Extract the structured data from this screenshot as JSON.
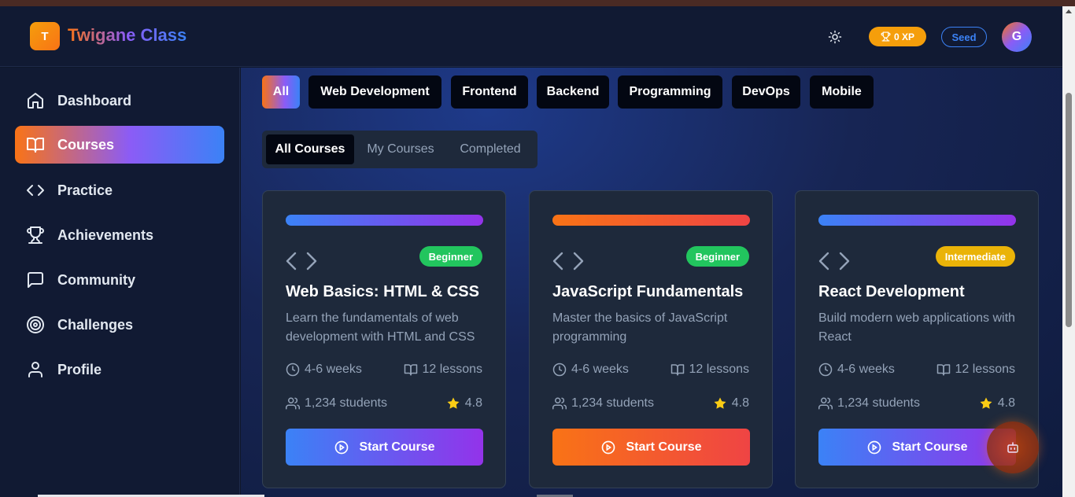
{
  "header": {
    "logo_letter": "T",
    "app_name": "Twigane Class",
    "xp_label": "0 XP",
    "rank_label": "Seed",
    "avatar_letter": "G"
  },
  "sidebar": {
    "items": [
      {
        "label": "Dashboard",
        "icon": "home-icon"
      },
      {
        "label": "Courses",
        "icon": "book-icon"
      },
      {
        "label": "Practice",
        "icon": "code-icon"
      },
      {
        "label": "Achievements",
        "icon": "trophy-icon"
      },
      {
        "label": "Community",
        "icon": "message-square-icon"
      },
      {
        "label": "Challenges",
        "icon": "target-icon"
      },
      {
        "label": "Profile",
        "icon": "user-icon"
      }
    ]
  },
  "categories": [
    "All",
    "Web Development",
    "Frontend",
    "Backend",
    "Programming",
    "DevOps",
    "Mobile"
  ],
  "tabs": [
    "All Courses",
    "My Courses",
    "Completed"
  ],
  "courses": [
    {
      "title": "Web Basics: HTML & CSS",
      "description": "Learn the fundamentals of web development with HTML and CSS",
      "level": "Beginner",
      "duration": "4-6 weeks",
      "lessons": "12 lessons",
      "students": "1,234 students",
      "rating": "4.8",
      "button": "Start Course"
    },
    {
      "title": "JavaScript Fundamentals",
      "description": "Master the basics of JavaScript programming",
      "level": "Beginner",
      "duration": "4-6 weeks",
      "lessons": "12 lessons",
      "students": "1,234 students",
      "rating": "4.8",
      "button": "Start Course"
    },
    {
      "title": "React Development",
      "description": "Build modern web applications with React",
      "level": "Intermediate",
      "duration": "4-6 weeks",
      "lessons": "12 lessons",
      "students": "1,234 students",
      "rating": "4.8",
      "button": "Start Course"
    }
  ],
  "colors": {
    "accent_orange": "#f97316",
    "accent_purple": "#8b5cf6",
    "accent_blue": "#3b82f6",
    "beginner_green": "#22c55e",
    "intermediate_yellow": "#eab308",
    "xp_gold": "#f59e0b",
    "star_yellow": "#facc15"
  }
}
